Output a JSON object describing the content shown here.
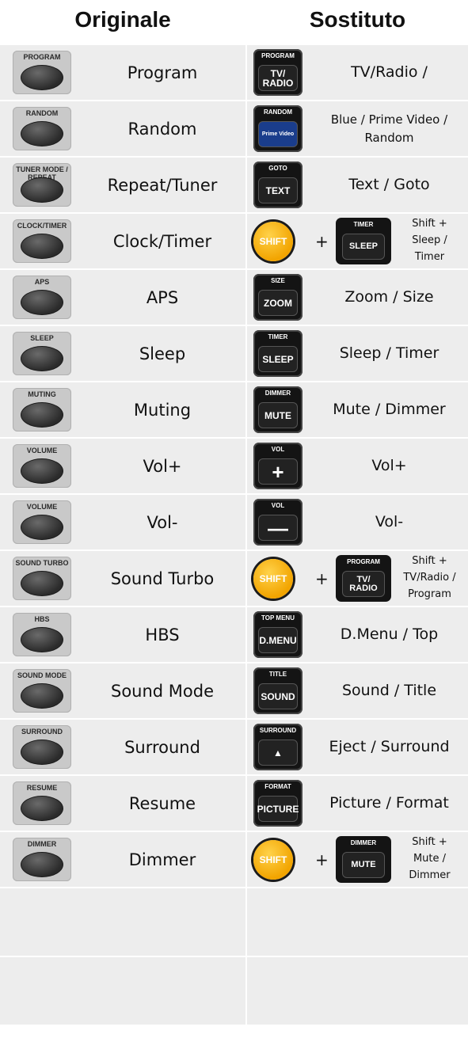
{
  "header": {
    "left": "Originale",
    "right": "Sostituto"
  },
  "rows": [
    {
      "orig_cap": "PROGRAM",
      "orig_label": "Program",
      "sub_top": "PROGRAM",
      "sub_main": "TV/ RADIO",
      "sub_label": "TV/Radio /"
    },
    {
      "orig_cap": "RANDOM",
      "orig_label": "Random",
      "sub_top": "RANDOM",
      "sub_main": "Prime Video",
      "sub_label": "Blue / Prime Video / Random"
    },
    {
      "orig_cap": "TUNER MODE / REPEAT",
      "orig_label": "Repeat/Tuner",
      "sub_top": "GOTO",
      "sub_main": "TEXT",
      "sub_label": "Text / Goto"
    },
    {
      "orig_cap": "CLOCK/TIMER",
      "orig_label": "Clock/Timer",
      "shift": "SHIFT",
      "plus": "+",
      "sub_top": "TIMER",
      "sub_main": "SLEEP",
      "sub_label": "Shift +\nSleep /\nTimer"
    },
    {
      "orig_cap": "APS",
      "orig_label": "APS",
      "sub_top": "SIZE",
      "sub_main": "ZOOM",
      "sub_label": "Zoom / Size"
    },
    {
      "orig_cap": "SLEEP",
      "orig_label": "Sleep",
      "sub_top": "TIMER",
      "sub_main": "SLEEP",
      "sub_label": "Sleep / Timer"
    },
    {
      "orig_cap": "MUTING",
      "orig_label": "Muting",
      "sub_top": "DIMMER",
      "sub_main": "MUTE",
      "sub_label": "Mute / Dimmer"
    },
    {
      "orig_cap": "VOLUME",
      "orig_label": "Vol+",
      "sub_top": "VOL",
      "sub_main": "+",
      "sub_label": "Vol+"
    },
    {
      "orig_cap": "VOLUME",
      "orig_label": "Vol-",
      "sub_top": "VOL",
      "sub_main": "—",
      "sub_label": "Vol-"
    },
    {
      "orig_cap": "SOUND TURBO",
      "orig_label": "Sound Turbo",
      "shift": "SHIFT",
      "plus": "+",
      "sub_top": "PROGRAM",
      "sub_main": "TV/ RADIO",
      "sub_label": "Shift +\nTV/Radio /\nProgram"
    },
    {
      "orig_cap": "HBS",
      "orig_label": "HBS",
      "sub_top": "TOP MENU",
      "sub_main": "D.MENU",
      "sub_label": "D.Menu / Top"
    },
    {
      "orig_cap": "SOUND MODE",
      "orig_label": "Sound Mode",
      "sub_top": "TITLE",
      "sub_main": "SOUND",
      "sub_label": "Sound / Title"
    },
    {
      "orig_cap": "SURROUND",
      "orig_label": "Surround",
      "sub_top": "SURROUND",
      "sub_main": "▲",
      "sub_label": "Eject / Surround"
    },
    {
      "orig_cap": "RESUME",
      "orig_label": "Resume",
      "sub_top": "FORMAT",
      "sub_main": "PICTURE",
      "sub_label": "Picture / Format"
    },
    {
      "orig_cap": "DIMMER",
      "orig_label": "Dimmer",
      "shift": "SHIFT",
      "plus": "+",
      "sub_top": "DIMMER",
      "sub_main": "MUTE",
      "sub_label": "Shift +\nMute /\nDimmer"
    }
  ],
  "empty_rows": 2
}
